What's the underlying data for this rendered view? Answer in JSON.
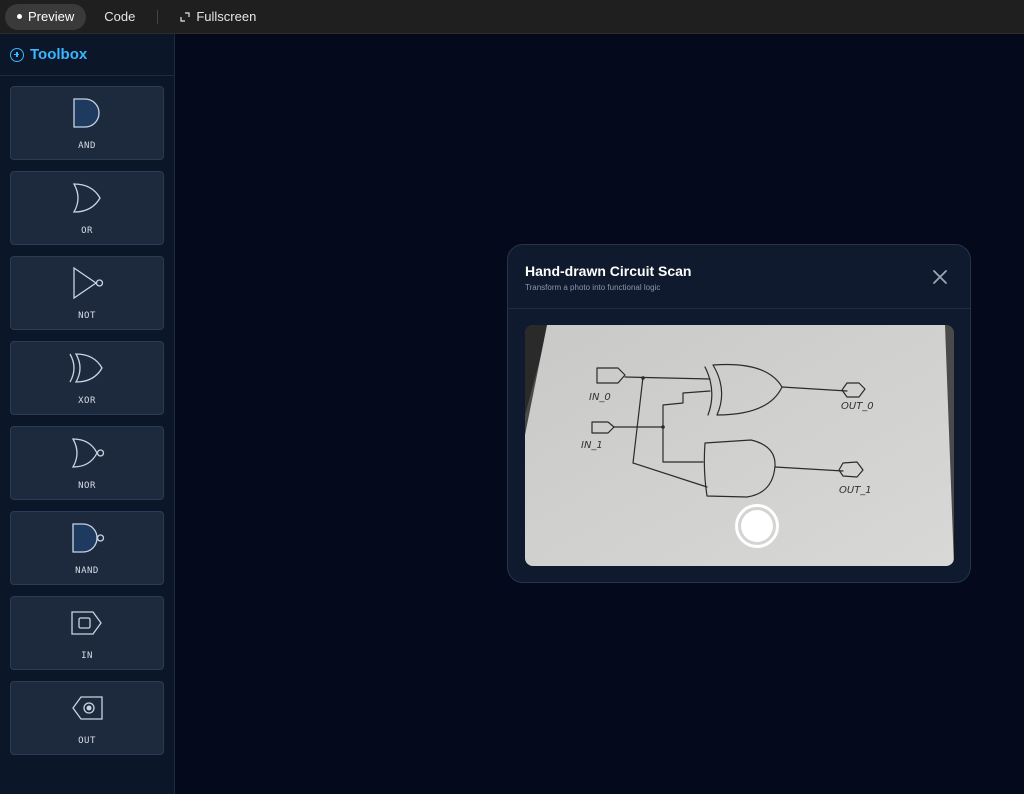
{
  "tabs": [
    {
      "label": "Preview",
      "active": true
    },
    {
      "label": "Code",
      "active": false
    },
    {
      "label": "Fullscreen",
      "active": false
    }
  ],
  "sidebar": {
    "title": "Toolbox",
    "items": [
      {
        "label": "AND",
        "icon": "and-gate-icon"
      },
      {
        "label": "OR",
        "icon": "or-gate-icon"
      },
      {
        "label": "NOT",
        "icon": "not-gate-icon"
      },
      {
        "label": "XOR",
        "icon": "xor-gate-icon"
      },
      {
        "label": "NOR",
        "icon": "nor-gate-icon"
      },
      {
        "label": "NAND",
        "icon": "nand-gate-icon"
      },
      {
        "label": "IN",
        "icon": "input-pin-icon"
      },
      {
        "label": "OUT",
        "icon": "output-pin-icon"
      }
    ]
  },
  "modal": {
    "title": "Hand-drawn Circuit Scan",
    "subtitle": "Transform a photo into functional logic",
    "close_icon": "close-icon",
    "photo": {
      "labels": [
        "IN_0",
        "IN_1",
        "OUT_0",
        "OUT_1"
      ]
    }
  },
  "colors": {
    "accent": "#38b6ff",
    "sidebar_bg": "#0b1628",
    "canvas_bg": "#040a1c",
    "modal_bg": "#0f1a2e"
  }
}
